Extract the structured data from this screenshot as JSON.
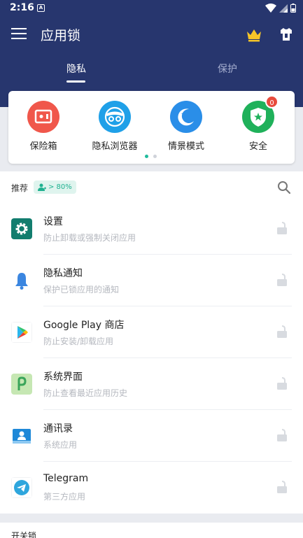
{
  "status_bar": {
    "time": "2:16",
    "notification_glyph": "A"
  },
  "app_bar": {
    "title": "应用锁",
    "menu_icon": "hamburger-menu-icon",
    "crown_icon": "crown-icon",
    "shirt_icon": "theme-shirt-icon"
  },
  "tabs": [
    {
      "label": "隐私",
      "active": true
    },
    {
      "label": "保护",
      "active": false
    }
  ],
  "features": [
    {
      "label": "保险箱",
      "icon": "vault-icon",
      "color": "#f0574b"
    },
    {
      "label": "隐私浏览器",
      "icon": "incognito-browser-icon",
      "color": "#1fa0e8"
    },
    {
      "label": "情景模式",
      "icon": "moon-star-icon",
      "color": "#2a8ee8"
    },
    {
      "label": "安全",
      "icon": "shield-star-icon",
      "color": "#1fb15a",
      "badge": "0"
    }
  ],
  "pager": {
    "pages": 2,
    "active": 0
  },
  "recommend": {
    "label": "推荐",
    "chip_text": "> 80%"
  },
  "apps": [
    {
      "name": "设置",
      "desc": "防止卸载或强制关闭应用",
      "icon": "settings-gear-icon"
    },
    {
      "name": "隐私通知",
      "desc": "保护已锁应用的通知",
      "icon": "bell-icon"
    },
    {
      "name": "Google Play 商店",
      "desc": "防止安装/卸载应用",
      "icon": "google-play-icon"
    },
    {
      "name": "系统界面",
      "desc": "防止查看最近应用历史",
      "icon": "android-p-icon"
    },
    {
      "name": "通讯录",
      "desc": "系统应用",
      "icon": "contacts-icon"
    },
    {
      "name": "Telegram",
      "desc": "第三方应用",
      "icon": "telegram-icon"
    }
  ],
  "switch_section": {
    "label": "开关锁"
  },
  "colors": {
    "header": "#27366e",
    "accent": "#1fbb9c",
    "badge": "#e84b3c",
    "lock": "#d8dbe0"
  }
}
